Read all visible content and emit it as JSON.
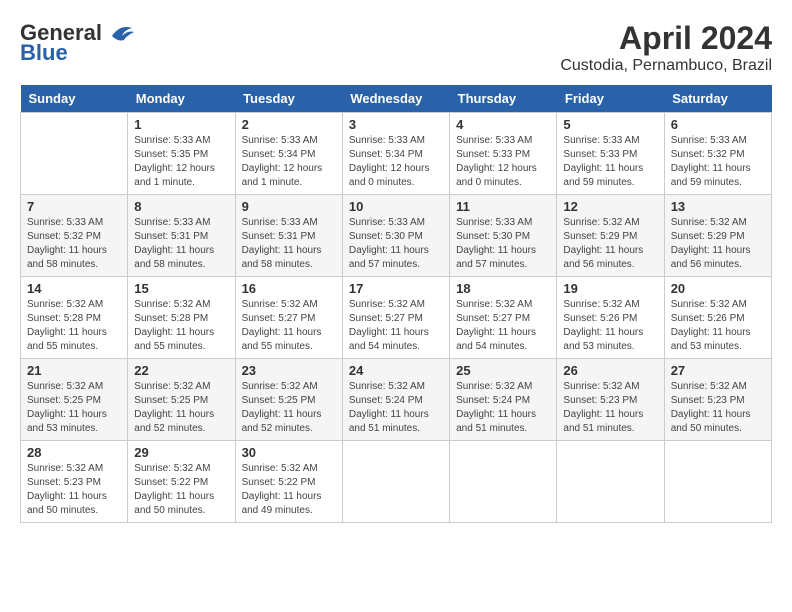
{
  "logo": {
    "general": "General",
    "blue": "Blue"
  },
  "title": {
    "month_year": "April 2024",
    "location": "Custodia, Pernambuco, Brazil"
  },
  "headers": [
    "Sunday",
    "Monday",
    "Tuesday",
    "Wednesday",
    "Thursday",
    "Friday",
    "Saturday"
  ],
  "weeks": [
    [
      {
        "num": "",
        "info": ""
      },
      {
        "num": "1",
        "info": "Sunrise: 5:33 AM\nSunset: 5:35 PM\nDaylight: 12 hours\nand 1 minute."
      },
      {
        "num": "2",
        "info": "Sunrise: 5:33 AM\nSunset: 5:34 PM\nDaylight: 12 hours\nand 1 minute."
      },
      {
        "num": "3",
        "info": "Sunrise: 5:33 AM\nSunset: 5:34 PM\nDaylight: 12 hours\nand 0 minutes."
      },
      {
        "num": "4",
        "info": "Sunrise: 5:33 AM\nSunset: 5:33 PM\nDaylight: 12 hours\nand 0 minutes."
      },
      {
        "num": "5",
        "info": "Sunrise: 5:33 AM\nSunset: 5:33 PM\nDaylight: 11 hours\nand 59 minutes."
      },
      {
        "num": "6",
        "info": "Sunrise: 5:33 AM\nSunset: 5:32 PM\nDaylight: 11 hours\nand 59 minutes."
      }
    ],
    [
      {
        "num": "7",
        "info": "Sunrise: 5:33 AM\nSunset: 5:32 PM\nDaylight: 11 hours\nand 58 minutes."
      },
      {
        "num": "8",
        "info": "Sunrise: 5:33 AM\nSunset: 5:31 PM\nDaylight: 11 hours\nand 58 minutes."
      },
      {
        "num": "9",
        "info": "Sunrise: 5:33 AM\nSunset: 5:31 PM\nDaylight: 11 hours\nand 58 minutes."
      },
      {
        "num": "10",
        "info": "Sunrise: 5:33 AM\nSunset: 5:30 PM\nDaylight: 11 hours\nand 57 minutes."
      },
      {
        "num": "11",
        "info": "Sunrise: 5:33 AM\nSunset: 5:30 PM\nDaylight: 11 hours\nand 57 minutes."
      },
      {
        "num": "12",
        "info": "Sunrise: 5:32 AM\nSunset: 5:29 PM\nDaylight: 11 hours\nand 56 minutes."
      },
      {
        "num": "13",
        "info": "Sunrise: 5:32 AM\nSunset: 5:29 PM\nDaylight: 11 hours\nand 56 minutes."
      }
    ],
    [
      {
        "num": "14",
        "info": "Sunrise: 5:32 AM\nSunset: 5:28 PM\nDaylight: 11 hours\nand 55 minutes."
      },
      {
        "num": "15",
        "info": "Sunrise: 5:32 AM\nSunset: 5:28 PM\nDaylight: 11 hours\nand 55 minutes."
      },
      {
        "num": "16",
        "info": "Sunrise: 5:32 AM\nSunset: 5:27 PM\nDaylight: 11 hours\nand 55 minutes."
      },
      {
        "num": "17",
        "info": "Sunrise: 5:32 AM\nSunset: 5:27 PM\nDaylight: 11 hours\nand 54 minutes."
      },
      {
        "num": "18",
        "info": "Sunrise: 5:32 AM\nSunset: 5:27 PM\nDaylight: 11 hours\nand 54 minutes."
      },
      {
        "num": "19",
        "info": "Sunrise: 5:32 AM\nSunset: 5:26 PM\nDaylight: 11 hours\nand 53 minutes."
      },
      {
        "num": "20",
        "info": "Sunrise: 5:32 AM\nSunset: 5:26 PM\nDaylight: 11 hours\nand 53 minutes."
      }
    ],
    [
      {
        "num": "21",
        "info": "Sunrise: 5:32 AM\nSunset: 5:25 PM\nDaylight: 11 hours\nand 53 minutes."
      },
      {
        "num": "22",
        "info": "Sunrise: 5:32 AM\nSunset: 5:25 PM\nDaylight: 11 hours\nand 52 minutes."
      },
      {
        "num": "23",
        "info": "Sunrise: 5:32 AM\nSunset: 5:25 PM\nDaylight: 11 hours\nand 52 minutes."
      },
      {
        "num": "24",
        "info": "Sunrise: 5:32 AM\nSunset: 5:24 PM\nDaylight: 11 hours\nand 51 minutes."
      },
      {
        "num": "25",
        "info": "Sunrise: 5:32 AM\nSunset: 5:24 PM\nDaylight: 11 hours\nand 51 minutes."
      },
      {
        "num": "26",
        "info": "Sunrise: 5:32 AM\nSunset: 5:23 PM\nDaylight: 11 hours\nand 51 minutes."
      },
      {
        "num": "27",
        "info": "Sunrise: 5:32 AM\nSunset: 5:23 PM\nDaylight: 11 hours\nand 50 minutes."
      }
    ],
    [
      {
        "num": "28",
        "info": "Sunrise: 5:32 AM\nSunset: 5:23 PM\nDaylight: 11 hours\nand 50 minutes."
      },
      {
        "num": "29",
        "info": "Sunrise: 5:32 AM\nSunset: 5:22 PM\nDaylight: 11 hours\nand 50 minutes."
      },
      {
        "num": "30",
        "info": "Sunrise: 5:32 AM\nSunset: 5:22 PM\nDaylight: 11 hours\nand 49 minutes."
      },
      {
        "num": "",
        "info": ""
      },
      {
        "num": "",
        "info": ""
      },
      {
        "num": "",
        "info": ""
      },
      {
        "num": "",
        "info": ""
      }
    ]
  ]
}
